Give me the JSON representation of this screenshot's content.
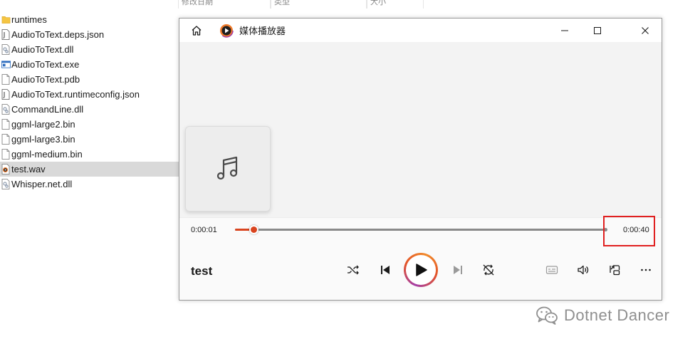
{
  "explorer": {
    "columns": [
      "修改日期",
      "类型",
      "大小"
    ],
    "files": [
      {
        "name": "runtimes",
        "type": "folder"
      },
      {
        "name": "AudioToText.deps.json",
        "type": "json"
      },
      {
        "name": "AudioToText.dll",
        "type": "dll"
      },
      {
        "name": "AudioToText.exe",
        "type": "exe"
      },
      {
        "name": "AudioToText.pdb",
        "type": "file"
      },
      {
        "name": "AudioToText.runtimeconfig.json",
        "type": "json"
      },
      {
        "name": "CommandLine.dll",
        "type": "dll"
      },
      {
        "name": "ggml-large2.bin",
        "type": "file"
      },
      {
        "name": "ggml-large3.bin",
        "type": "file"
      },
      {
        "name": "ggml-medium.bin",
        "type": "file"
      },
      {
        "name": "test.wav",
        "type": "audio",
        "selected": true
      },
      {
        "name": "Whisper.net.dll",
        "type": "dll"
      }
    ]
  },
  "player": {
    "title": "媒体播放器",
    "track_title": "test",
    "time_current": "0:00:01",
    "time_total": "0:00:40",
    "progress_fraction": 0.05
  },
  "colors": {
    "accent": "#d9441f",
    "highlight": "#e02020"
  },
  "watermark": {
    "text": "Dotnet Dancer"
  }
}
